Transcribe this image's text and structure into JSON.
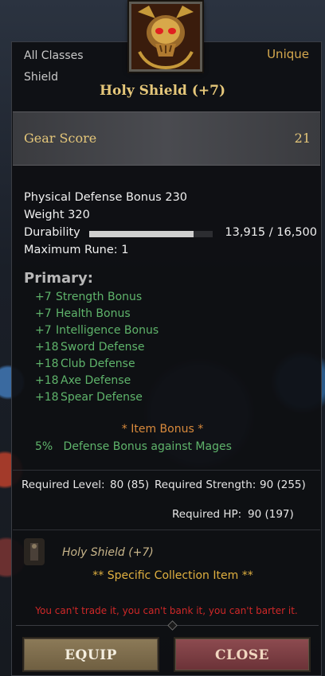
{
  "item": {
    "class_line": "All Classes",
    "type_line": "Shield",
    "rarity": "Unique",
    "name": "Holy Shield (+7)",
    "icon": "demon-skull-shield-icon"
  },
  "gear_score": {
    "label": "Gear Score",
    "value": "21"
  },
  "stats": {
    "physical_defense": "Physical Defense Bonus 230",
    "weight": "Weight 320",
    "durability_label": "Durability",
    "durability_value": "13,915 / 16,500",
    "durability_fraction": 0.843,
    "max_rune": "Maximum Rune: 1"
  },
  "primary": {
    "heading": "Primary:",
    "bonuses": [
      {
        "value": "+7",
        "label": "Strength Bonus"
      },
      {
        "value": "+7",
        "label": "Health Bonus"
      },
      {
        "value": "+7",
        "label": "Intelligence Bonus"
      },
      {
        "value": "+18",
        "label": "Sword Defense"
      },
      {
        "value": "+18",
        "label": "Club Defense"
      },
      {
        "value": "+18",
        "label": "Axe Defense"
      },
      {
        "value": "+18",
        "label": "Spear Defense"
      }
    ]
  },
  "item_bonus": {
    "heading": "* Item Bonus *",
    "line": "5%   Defense Bonus against Mages"
  },
  "requirements": {
    "level_label": "Required Level:",
    "level_value": "80 (85)",
    "strength_label": "Required Strength:",
    "strength_value": "90 (255)",
    "hp_label": "Required HP:",
    "hp_value": "90 (197)"
  },
  "collection": {
    "name": "Holy Shield (+7)",
    "tag": "** Specific Collection Item **"
  },
  "warning": "You can't trade it, you can't bank it, you can't barter it.",
  "buttons": {
    "equip": "EQUIP",
    "close": "CLOSE"
  },
  "colors": {
    "gold": "#e5c77a",
    "green": "#5fb46b",
    "orange": "#d98a3c",
    "red": "#d02828",
    "equip_button": "#7d6c4c",
    "close_button": "#7c3f44"
  }
}
